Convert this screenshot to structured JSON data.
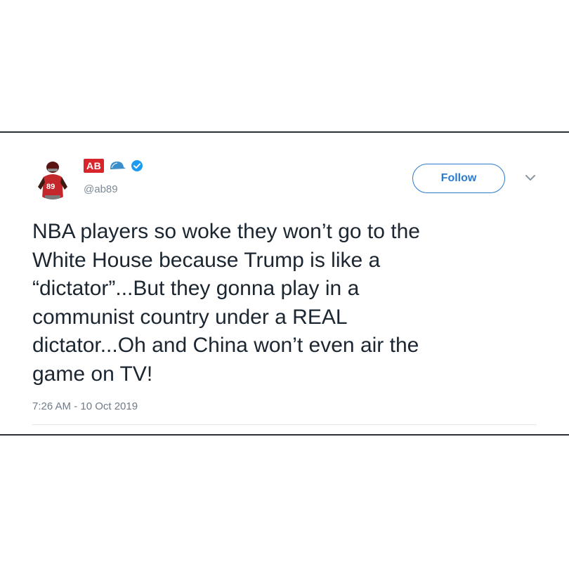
{
  "tweet": {
    "logo_text": "AB",
    "handle": "@ab89",
    "follow_label": "Follow",
    "text": "NBA players so woke they won’t go to the\nWhite House because Trump is like a\n“dictator”...But they gonna play in a\ncommunist country under a REAL\ndictator...Oh and China won’t even air the\ngame on TV!",
    "timestamp": "7:26 AM - 10 Oct 2019",
    "icons": [
      "avatar-photo",
      "cap-icon",
      "verified-icon",
      "chevron-down-icon"
    ],
    "colors": {
      "accent": "#2b7bd1",
      "logo_red": "#d8252b",
      "text": "#1b2631",
      "muted": "#7d8a96"
    }
  }
}
